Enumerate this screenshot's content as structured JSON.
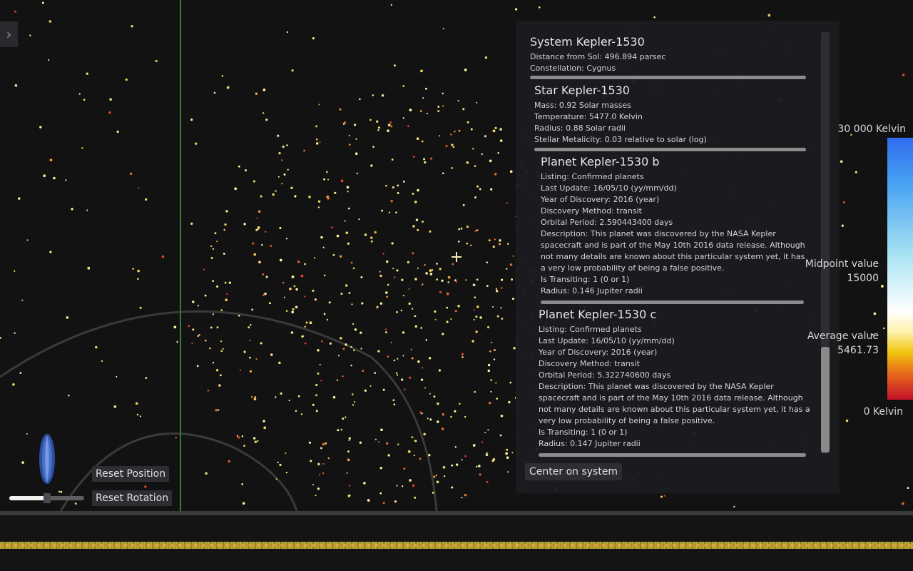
{
  "system": {
    "title": "System Kepler-1530",
    "distance": "Distance from Sol: 496.894 parsec",
    "constellation": "Constellation: Cygnus"
  },
  "star": {
    "title": "Star Kepler-1530",
    "mass": "Mass: 0.92 Solar masses",
    "temperature": "Temperature: 5477.0 Kelvin",
    "radius": "Radius: 0.88 Solar radii",
    "metalicity": "Stellar Metalicity: 0.03 relative to solar (log)"
  },
  "planets": [
    {
      "title": "Planet Kepler-1530 b",
      "listing": "Listing: Confirmed planets",
      "last_update": "Last Update: 16/05/10 (yy/mm/dd)",
      "year": "Year of Discovery: 2016 (year)",
      "method": "Discovery Method: transit",
      "period": "Orbital Period: 2.590443400 days",
      "description": "Description: This planet was discovered by the NASA Kepler spacecraft and is part of the May 10th 2016 data release. Although not many details are known about this particular system yet, it has a very low probability of being a false positive.",
      "transiting": "Is Transiting: 1 (0 or 1)",
      "radius": "Radius: 0.146 Jupiter radii"
    },
    {
      "title": "Planet Kepler-1530 c",
      "listing": "Listing: Confirmed planets",
      "last_update": "Last Update: 16/05/10 (yy/mm/dd)",
      "year": "Year of Discovery: 2016 (year)",
      "method": "Discovery Method: transit",
      "period": "Orbital Period: 5.322740600 days",
      "description": "Description: This planet was discovered by the NASA Kepler spacecraft and is part of the May 10th 2016 data release. Although not many details are known about this particular system yet, it has a very low probability of being a false positive.",
      "transiting": "Is Transiting: 1 (0 or 1)",
      "radius": "Radius: 0.147 Jupiter radii"
    }
  ],
  "buttons": {
    "center": "Center on system",
    "reset_position": "Reset Position",
    "reset_rotation": "Reset Rotation"
  },
  "scale": {
    "max_label": "30 000 Kelvin",
    "midpoint_label": "Midpoint value",
    "midpoint_value": "15000",
    "average_label": "Average value",
    "average_value": "5461.73",
    "min_label": "0 Kelvin"
  },
  "icons": {
    "sidebar_toggle": "chevron-right-icon",
    "rotation": "rotation-wheel-icon",
    "crosshair": "crosshair-icon"
  },
  "colors": {
    "background": "#121212",
    "panel": "#1c1c20",
    "star_yellow": "#f4e07a",
    "star_red": "#e0452a",
    "axis_green": "#3f7a3a"
  },
  "rotation_slider": {
    "fraction": 0.5
  },
  "info_scroll": {
    "thumb_position_fraction": 0.75
  }
}
